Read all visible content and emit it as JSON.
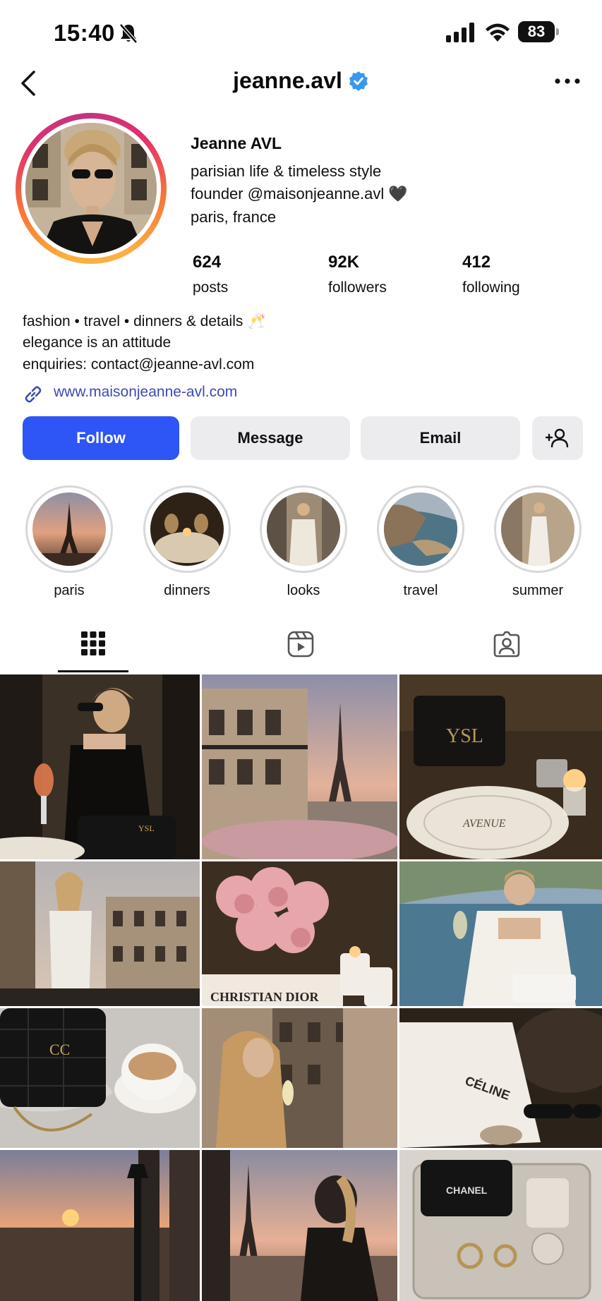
{
  "status_bar": {
    "time": "15:40",
    "battery": "83"
  },
  "header": {
    "username": "jeanne.avl"
  },
  "profile": {
    "display_name": "Jeanne AVL",
    "bio": [
      "parisian life & timeless style",
      "founder @maisonjeanne.avl 🖤",
      "paris, france"
    ],
    "stats": [
      {
        "value": "624",
        "label": "posts"
      },
      {
        "value": "92K",
        "label": "followers"
      },
      {
        "value": "412",
        "label": "following"
      }
    ],
    "description": [
      "fashion • travel • dinners & details 🥂",
      "elegance is an attitude",
      "enquiries: contact@jeanne-avl.com"
    ],
    "link": "www.maisonjeanne-avl.com"
  },
  "actions": {
    "follow": "Follow",
    "message": "Message",
    "email": "Email"
  },
  "highlights": [
    {
      "label": "paris"
    },
    {
      "label": "dinners"
    },
    {
      "label": "looks"
    },
    {
      "label": "travel"
    },
    {
      "label": "summer"
    }
  ],
  "grid_text": {
    "dior_book": "CHRISTIAN DIOR",
    "plate": "AVENUE",
    "celine_bag": "CÉLINE",
    "chanel_box": "CHANEL"
  },
  "colors": {
    "accent": "#2e55f5",
    "verified": "#3897f0",
    "link": "#3b4bb3"
  }
}
